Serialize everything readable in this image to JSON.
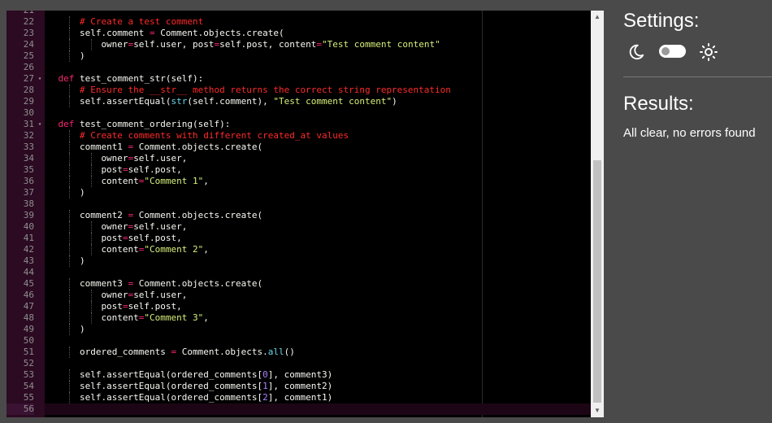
{
  "editor": {
    "active_line": 56,
    "lines": [
      {
        "n": "21",
        "fold": "",
        "indent": 0,
        "tokens": []
      },
      {
        "n": "22",
        "fold": "",
        "indent": 2,
        "tokens": [
          {
            "t": "# Create a test comment",
            "c": "cm"
          }
        ]
      },
      {
        "n": "23",
        "fold": "",
        "indent": 2,
        "tokens": [
          {
            "t": "self.comment ",
            "c": "tx"
          },
          {
            "t": "=",
            "c": "op"
          },
          {
            "t": " Comment.objects.create(",
            "c": "tx"
          }
        ]
      },
      {
        "n": "24",
        "fold": "",
        "indent": 3,
        "tokens": [
          {
            "t": "owner",
            "c": "tx"
          },
          {
            "t": "=",
            "c": "op"
          },
          {
            "t": "self.user, post",
            "c": "tx"
          },
          {
            "t": "=",
            "c": "op"
          },
          {
            "t": "self.post, content",
            "c": "tx"
          },
          {
            "t": "=",
            "c": "op"
          },
          {
            "t": "\"Test comment content\"",
            "c": "str"
          }
        ]
      },
      {
        "n": "25",
        "fold": "",
        "indent": 2,
        "tokens": [
          {
            "t": ")",
            "c": "tx"
          }
        ]
      },
      {
        "n": "26",
        "fold": "",
        "indent": 0,
        "tokens": []
      },
      {
        "n": "27",
        "fold": "▾",
        "indent": 1,
        "tokens": [
          {
            "t": "def ",
            "c": "kw"
          },
          {
            "t": "test_comment_str(self):",
            "c": "tx"
          }
        ]
      },
      {
        "n": "28",
        "fold": "",
        "indent": 2,
        "tokens": [
          {
            "t": "# Ensure the __str__ method returns the correct string representation",
            "c": "cm"
          }
        ]
      },
      {
        "n": "29",
        "fold": "",
        "indent": 2,
        "tokens": [
          {
            "t": "self.assertEqual(",
            "c": "tx"
          },
          {
            "t": "str",
            "c": "fn"
          },
          {
            "t": "(self.comment), ",
            "c": "tx"
          },
          {
            "t": "\"Test comment content\"",
            "c": "str"
          },
          {
            "t": ")",
            "c": "tx"
          }
        ]
      },
      {
        "n": "30",
        "fold": "",
        "indent": 0,
        "tokens": []
      },
      {
        "n": "31",
        "fold": "▾",
        "indent": 1,
        "tokens": [
          {
            "t": "def ",
            "c": "kw"
          },
          {
            "t": "test_comment_ordering(self):",
            "c": "tx"
          }
        ]
      },
      {
        "n": "32",
        "fold": "",
        "indent": 2,
        "tokens": [
          {
            "t": "# Create comments with different created_at values",
            "c": "cm"
          }
        ]
      },
      {
        "n": "33",
        "fold": "",
        "indent": 2,
        "tokens": [
          {
            "t": "comment1 ",
            "c": "tx"
          },
          {
            "t": "=",
            "c": "op"
          },
          {
            "t": " Comment.objects.create(",
            "c": "tx"
          }
        ]
      },
      {
        "n": "34",
        "fold": "",
        "indent": 3,
        "tokens": [
          {
            "t": "owner",
            "c": "tx"
          },
          {
            "t": "=",
            "c": "op"
          },
          {
            "t": "self.user,",
            "c": "tx"
          }
        ]
      },
      {
        "n": "35",
        "fold": "",
        "indent": 3,
        "tokens": [
          {
            "t": "post",
            "c": "tx"
          },
          {
            "t": "=",
            "c": "op"
          },
          {
            "t": "self.post,",
            "c": "tx"
          }
        ]
      },
      {
        "n": "36",
        "fold": "",
        "indent": 3,
        "tokens": [
          {
            "t": "content",
            "c": "tx"
          },
          {
            "t": "=",
            "c": "op"
          },
          {
            "t": "\"Comment 1\"",
            "c": "str"
          },
          {
            "t": ",",
            "c": "tx"
          }
        ]
      },
      {
        "n": "37",
        "fold": "",
        "indent": 2,
        "tokens": [
          {
            "t": ")",
            "c": "tx"
          }
        ]
      },
      {
        "n": "38",
        "fold": "",
        "indent": 0,
        "tokens": []
      },
      {
        "n": "39",
        "fold": "",
        "indent": 2,
        "tokens": [
          {
            "t": "comment2 ",
            "c": "tx"
          },
          {
            "t": "=",
            "c": "op"
          },
          {
            "t": " Comment.objects.create(",
            "c": "tx"
          }
        ]
      },
      {
        "n": "40",
        "fold": "",
        "indent": 3,
        "tokens": [
          {
            "t": "owner",
            "c": "tx"
          },
          {
            "t": "=",
            "c": "op"
          },
          {
            "t": "self.user,",
            "c": "tx"
          }
        ]
      },
      {
        "n": "41",
        "fold": "",
        "indent": 3,
        "tokens": [
          {
            "t": "post",
            "c": "tx"
          },
          {
            "t": "=",
            "c": "op"
          },
          {
            "t": "self.post,",
            "c": "tx"
          }
        ]
      },
      {
        "n": "42",
        "fold": "",
        "indent": 3,
        "tokens": [
          {
            "t": "content",
            "c": "tx"
          },
          {
            "t": "=",
            "c": "op"
          },
          {
            "t": "\"Comment 2\"",
            "c": "str"
          },
          {
            "t": ",",
            "c": "tx"
          }
        ]
      },
      {
        "n": "43",
        "fold": "",
        "indent": 2,
        "tokens": [
          {
            "t": ")",
            "c": "tx"
          }
        ]
      },
      {
        "n": "44",
        "fold": "",
        "indent": 0,
        "tokens": []
      },
      {
        "n": "45",
        "fold": "",
        "indent": 2,
        "tokens": [
          {
            "t": "comment3 ",
            "c": "tx"
          },
          {
            "t": "=",
            "c": "op"
          },
          {
            "t": " Comment.objects.create(",
            "c": "tx"
          }
        ]
      },
      {
        "n": "46",
        "fold": "",
        "indent": 3,
        "tokens": [
          {
            "t": "owner",
            "c": "tx"
          },
          {
            "t": "=",
            "c": "op"
          },
          {
            "t": "self.user,",
            "c": "tx"
          }
        ]
      },
      {
        "n": "47",
        "fold": "",
        "indent": 3,
        "tokens": [
          {
            "t": "post",
            "c": "tx"
          },
          {
            "t": "=",
            "c": "op"
          },
          {
            "t": "self.post,",
            "c": "tx"
          }
        ]
      },
      {
        "n": "48",
        "fold": "",
        "indent": 3,
        "tokens": [
          {
            "t": "content",
            "c": "tx"
          },
          {
            "t": "=",
            "c": "op"
          },
          {
            "t": "\"Comment 3\"",
            "c": "str"
          },
          {
            "t": ",",
            "c": "tx"
          }
        ]
      },
      {
        "n": "49",
        "fold": "",
        "indent": 2,
        "tokens": [
          {
            "t": ")",
            "c": "tx"
          }
        ]
      },
      {
        "n": "50",
        "fold": "",
        "indent": 0,
        "tokens": []
      },
      {
        "n": "51",
        "fold": "",
        "indent": 2,
        "tokens": [
          {
            "t": "ordered_comments ",
            "c": "tx"
          },
          {
            "t": "=",
            "c": "op"
          },
          {
            "t": " Comment.objects.",
            "c": "tx"
          },
          {
            "t": "all",
            "c": "fn"
          },
          {
            "t": "()",
            "c": "tx"
          }
        ]
      },
      {
        "n": "52",
        "fold": "",
        "indent": 0,
        "tokens": []
      },
      {
        "n": "53",
        "fold": "",
        "indent": 2,
        "tokens": [
          {
            "t": "self.assertEqual(ordered_comments[",
            "c": "tx"
          },
          {
            "t": "0",
            "c": "num"
          },
          {
            "t": "], comment3)",
            "c": "tx"
          }
        ]
      },
      {
        "n": "54",
        "fold": "",
        "indent": 2,
        "tokens": [
          {
            "t": "self.assertEqual(ordered_comments[",
            "c": "tx"
          },
          {
            "t": "1",
            "c": "num"
          },
          {
            "t": "], comment2)",
            "c": "tx"
          }
        ]
      },
      {
        "n": "55",
        "fold": "",
        "indent": 2,
        "tokens": [
          {
            "t": "self.assertEqual(ordered_comments[",
            "c": "tx"
          },
          {
            "t": "2",
            "c": "num"
          },
          {
            "t": "], comment1)",
            "c": "tx"
          }
        ]
      },
      {
        "n": "56",
        "fold": "",
        "indent": 0,
        "tokens": []
      }
    ]
  },
  "scrollbar": {
    "up_icon": "triangle-up-icon",
    "down_icon": "triangle-down-icon"
  },
  "settings": {
    "title": "Settings:",
    "moon_icon": "moon-icon",
    "sun_icon": "sun-icon",
    "theme_is_light": false
  },
  "results": {
    "title": "Results:",
    "message": "All clear, no errors found"
  },
  "colors": {
    "background": "#4a4a4a",
    "editor_bg": "#000000",
    "gutter_bg": "#2b0a22",
    "comment": "#ff2a2a",
    "keyword": "#f92672",
    "string": "#d6f07a",
    "builtin": "#66d9ef",
    "number": "#ae81ff"
  }
}
